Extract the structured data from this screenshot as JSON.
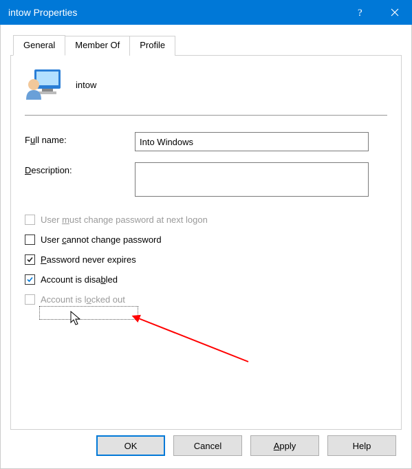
{
  "titlebar": {
    "title": "intow Properties"
  },
  "tabs": [
    {
      "label": "General",
      "active": true
    },
    {
      "label": "Member Of",
      "active": false
    },
    {
      "label": "Profile",
      "active": false
    }
  ],
  "user": {
    "name": "intow"
  },
  "fields": {
    "fullname_label_pre": "F",
    "fullname_label_u": "u",
    "fullname_label_post": "ll name:",
    "fullname_value": "Into Windows",
    "description_label_u": "D",
    "description_label_post": "escription:",
    "description_value": ""
  },
  "checks": {
    "must_change_pre": "User ",
    "must_change_u": "m",
    "must_change_post": "ust change password at next logon",
    "cannot_pre": "User ",
    "cannot_u": "c",
    "cannot_post": "annot change password",
    "neverexp_u": "P",
    "neverexp_post": "assword never expires",
    "disabled_pre": "Account is disa",
    "disabled_u": "b",
    "disabled_post": "led",
    "locked_pre": "Account is l",
    "locked_u": "o",
    "locked_post": "cked out"
  },
  "buttons": {
    "ok": "OK",
    "cancel": "Cancel",
    "apply_u": "A",
    "apply_post": "pply",
    "help": "Help"
  }
}
